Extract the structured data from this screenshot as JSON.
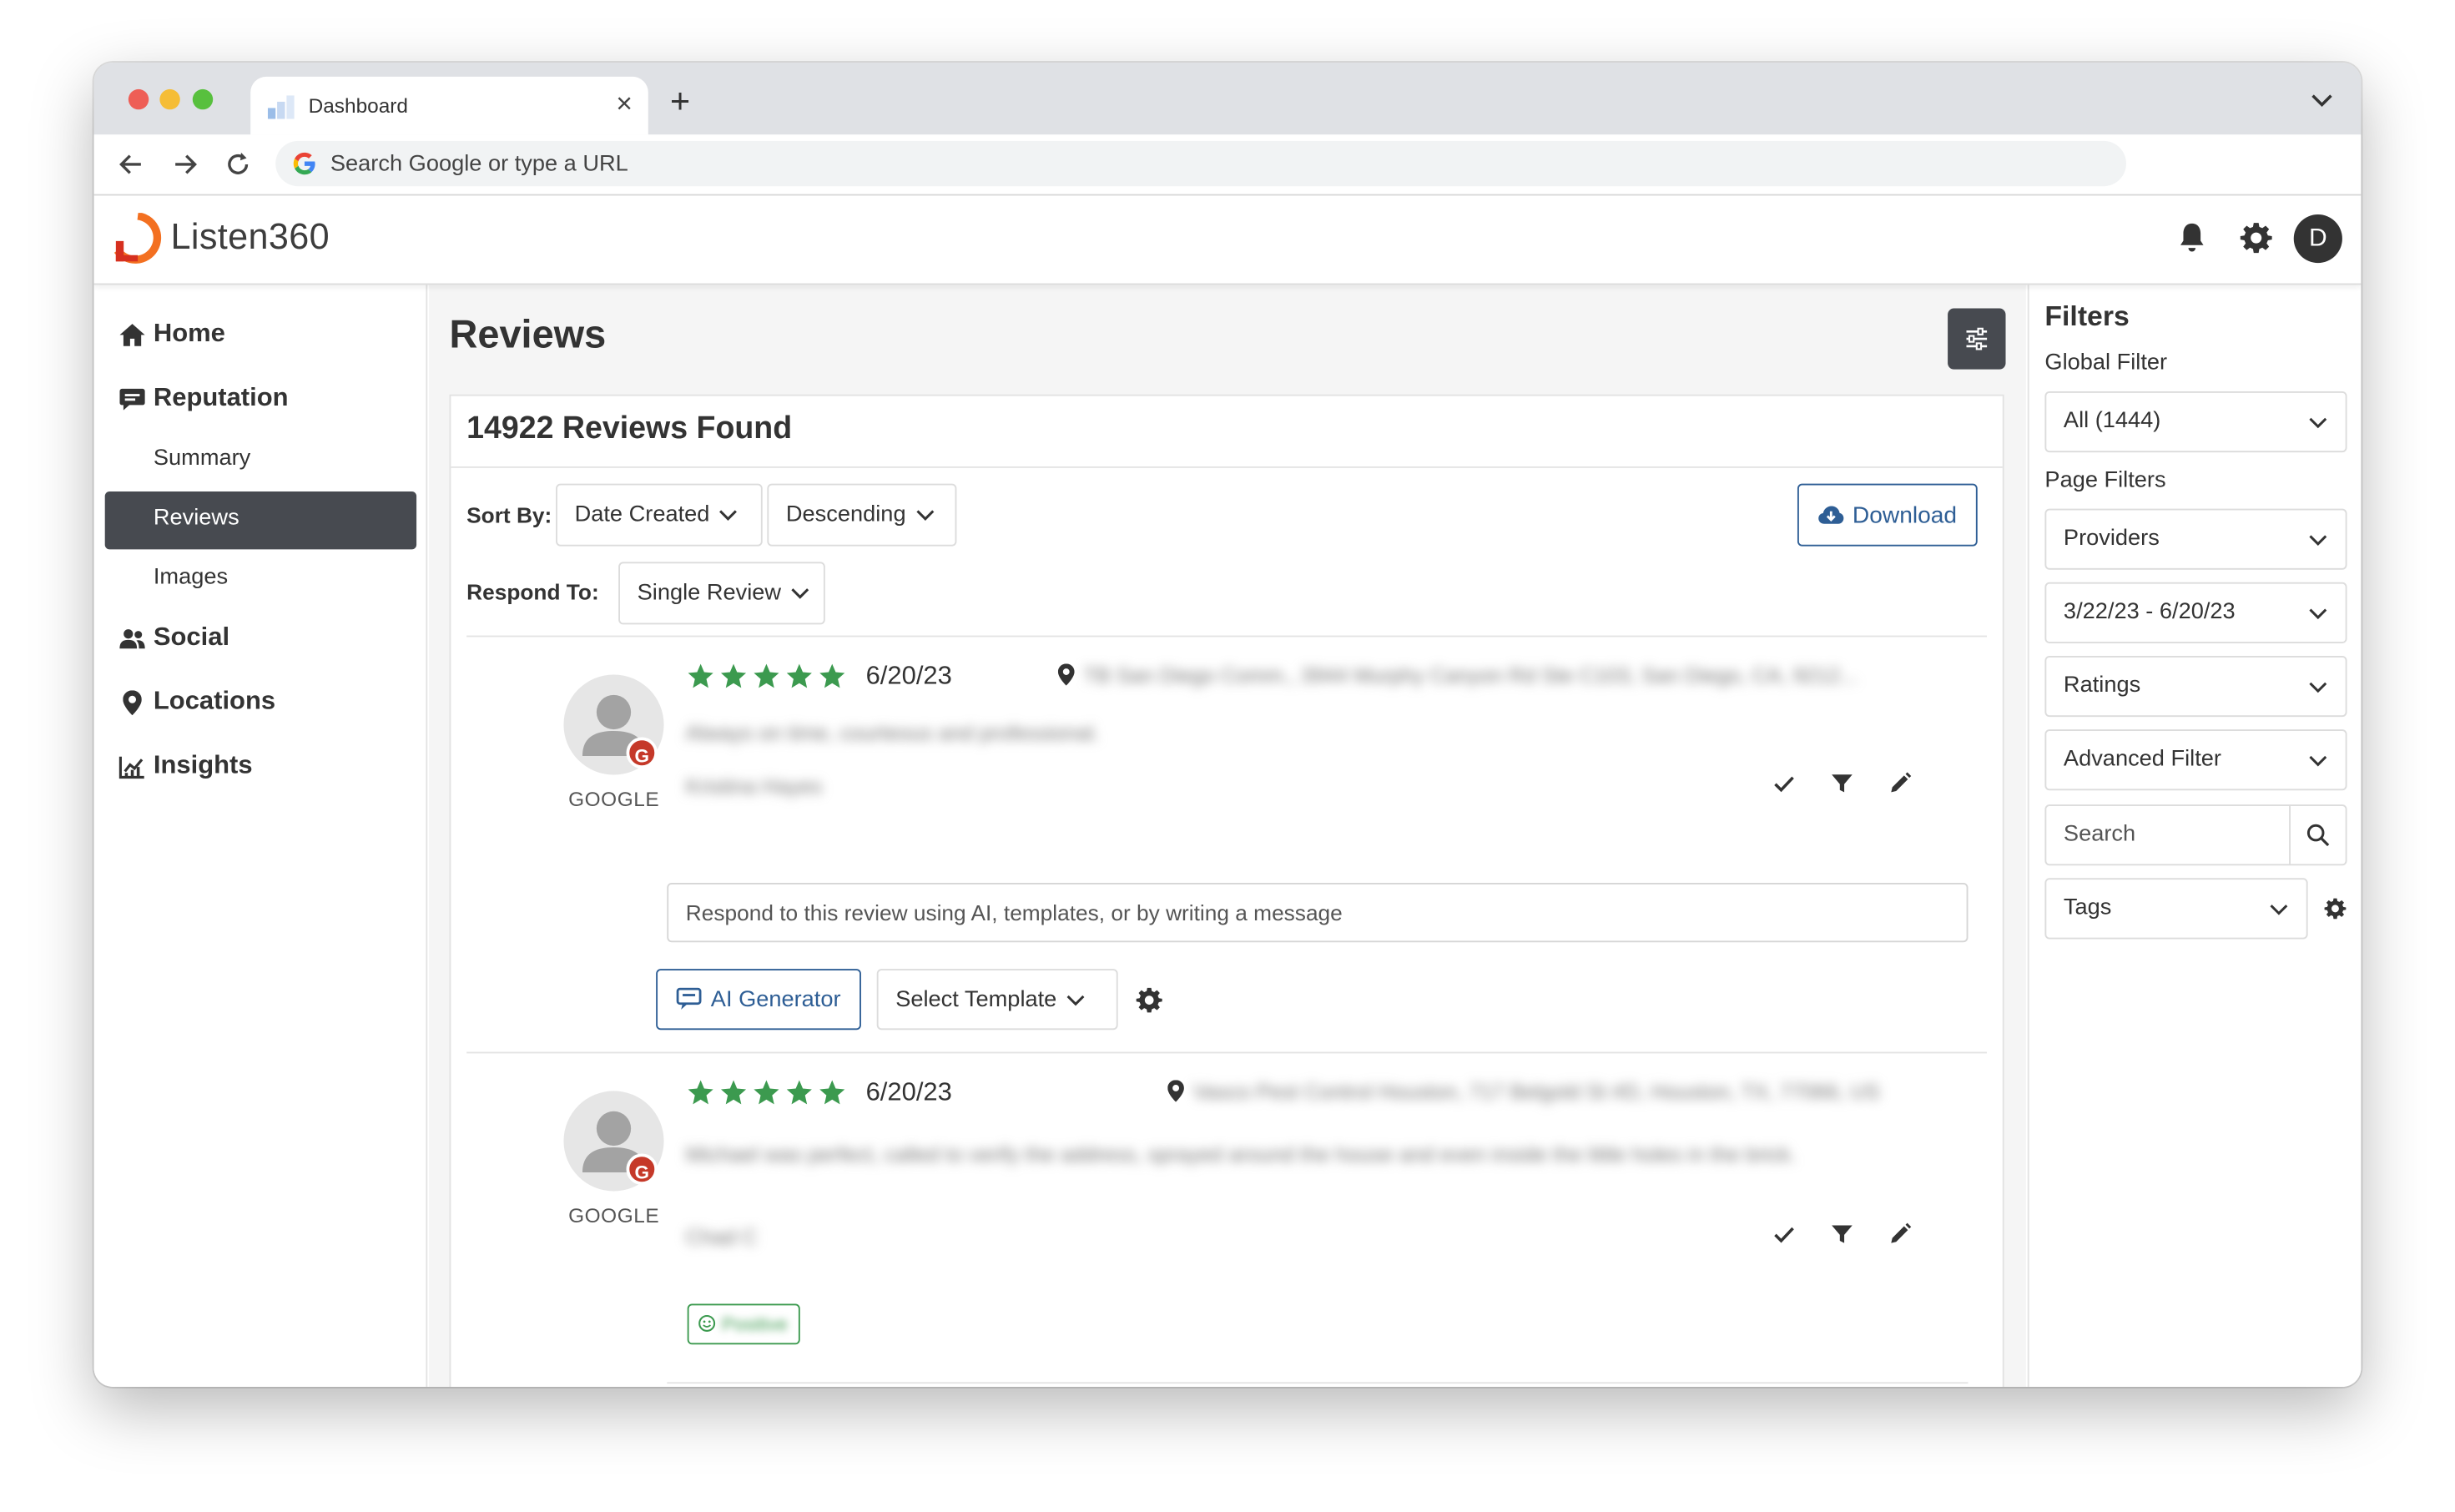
{
  "browser": {
    "tab_title": "Dashboard",
    "omnibox_placeholder": "Search Google or type a URL"
  },
  "app": {
    "logo_text": "Listen360",
    "user_initial": "D"
  },
  "sidebar": {
    "items": [
      {
        "label": "Home",
        "icon": "home-icon"
      },
      {
        "label": "Reputation",
        "icon": "comment-icon"
      },
      {
        "label": "Summary"
      },
      {
        "label": "Reviews",
        "active": true
      },
      {
        "label": "Images"
      },
      {
        "label": "Social",
        "icon": "users-icon"
      },
      {
        "label": "Locations",
        "icon": "map-pin-icon"
      },
      {
        "label": "Insights",
        "icon": "chart-icon"
      }
    ]
  },
  "main": {
    "title": "Reviews",
    "count_title": "14922 Reviews Found",
    "sort_label": "Sort By:",
    "sort_field": "Date Created",
    "sort_order": "Descending",
    "respond_label": "Respond To:",
    "respond_mode": "Single Review",
    "download_label": "Download"
  },
  "reviews": [
    {
      "provider": "GOOGLE",
      "rating": 5,
      "date": "6/20/23",
      "location": "TB San Diego Comm., 3944 Murphy Canyon Rd Ste C103, San Diego, CA, 9212...",
      "text": "Always on time, courteous and professional.",
      "author": "Kristina Hayes",
      "respond_placeholder": "Respond to this review using AI, templates, or by writing a message",
      "ai_label": "AI Generator",
      "template_label": "Select Template"
    },
    {
      "provider": "GOOGLE",
      "rating": 5,
      "date": "6/20/23",
      "location": "Vasco Pest Control Houston, 717 Belgold St #D, Houston, TX, 77066, US",
      "text": "Michael was perfect, called to verify the address, sprayed around the house and even inside the little holes in the brick.",
      "author": "Chad C",
      "tag": "Positive"
    }
  ],
  "filters": {
    "title": "Filters",
    "global_label": "Global Filter",
    "global_value": "All (1444)",
    "page_label": "Page Filters",
    "providers": "Providers",
    "date_range": "3/22/23 - 6/20/23",
    "ratings": "Ratings",
    "advanced": "Advanced Filter",
    "search_placeholder": "Search",
    "tags": "Tags"
  },
  "colors": {
    "accent": "#2e5e95",
    "dark_button": "#474a50",
    "star": "#3c9a4f",
    "google_badge": "#c53929",
    "logo_orange": "#f37021",
    "logo_red": "#d6301f"
  }
}
